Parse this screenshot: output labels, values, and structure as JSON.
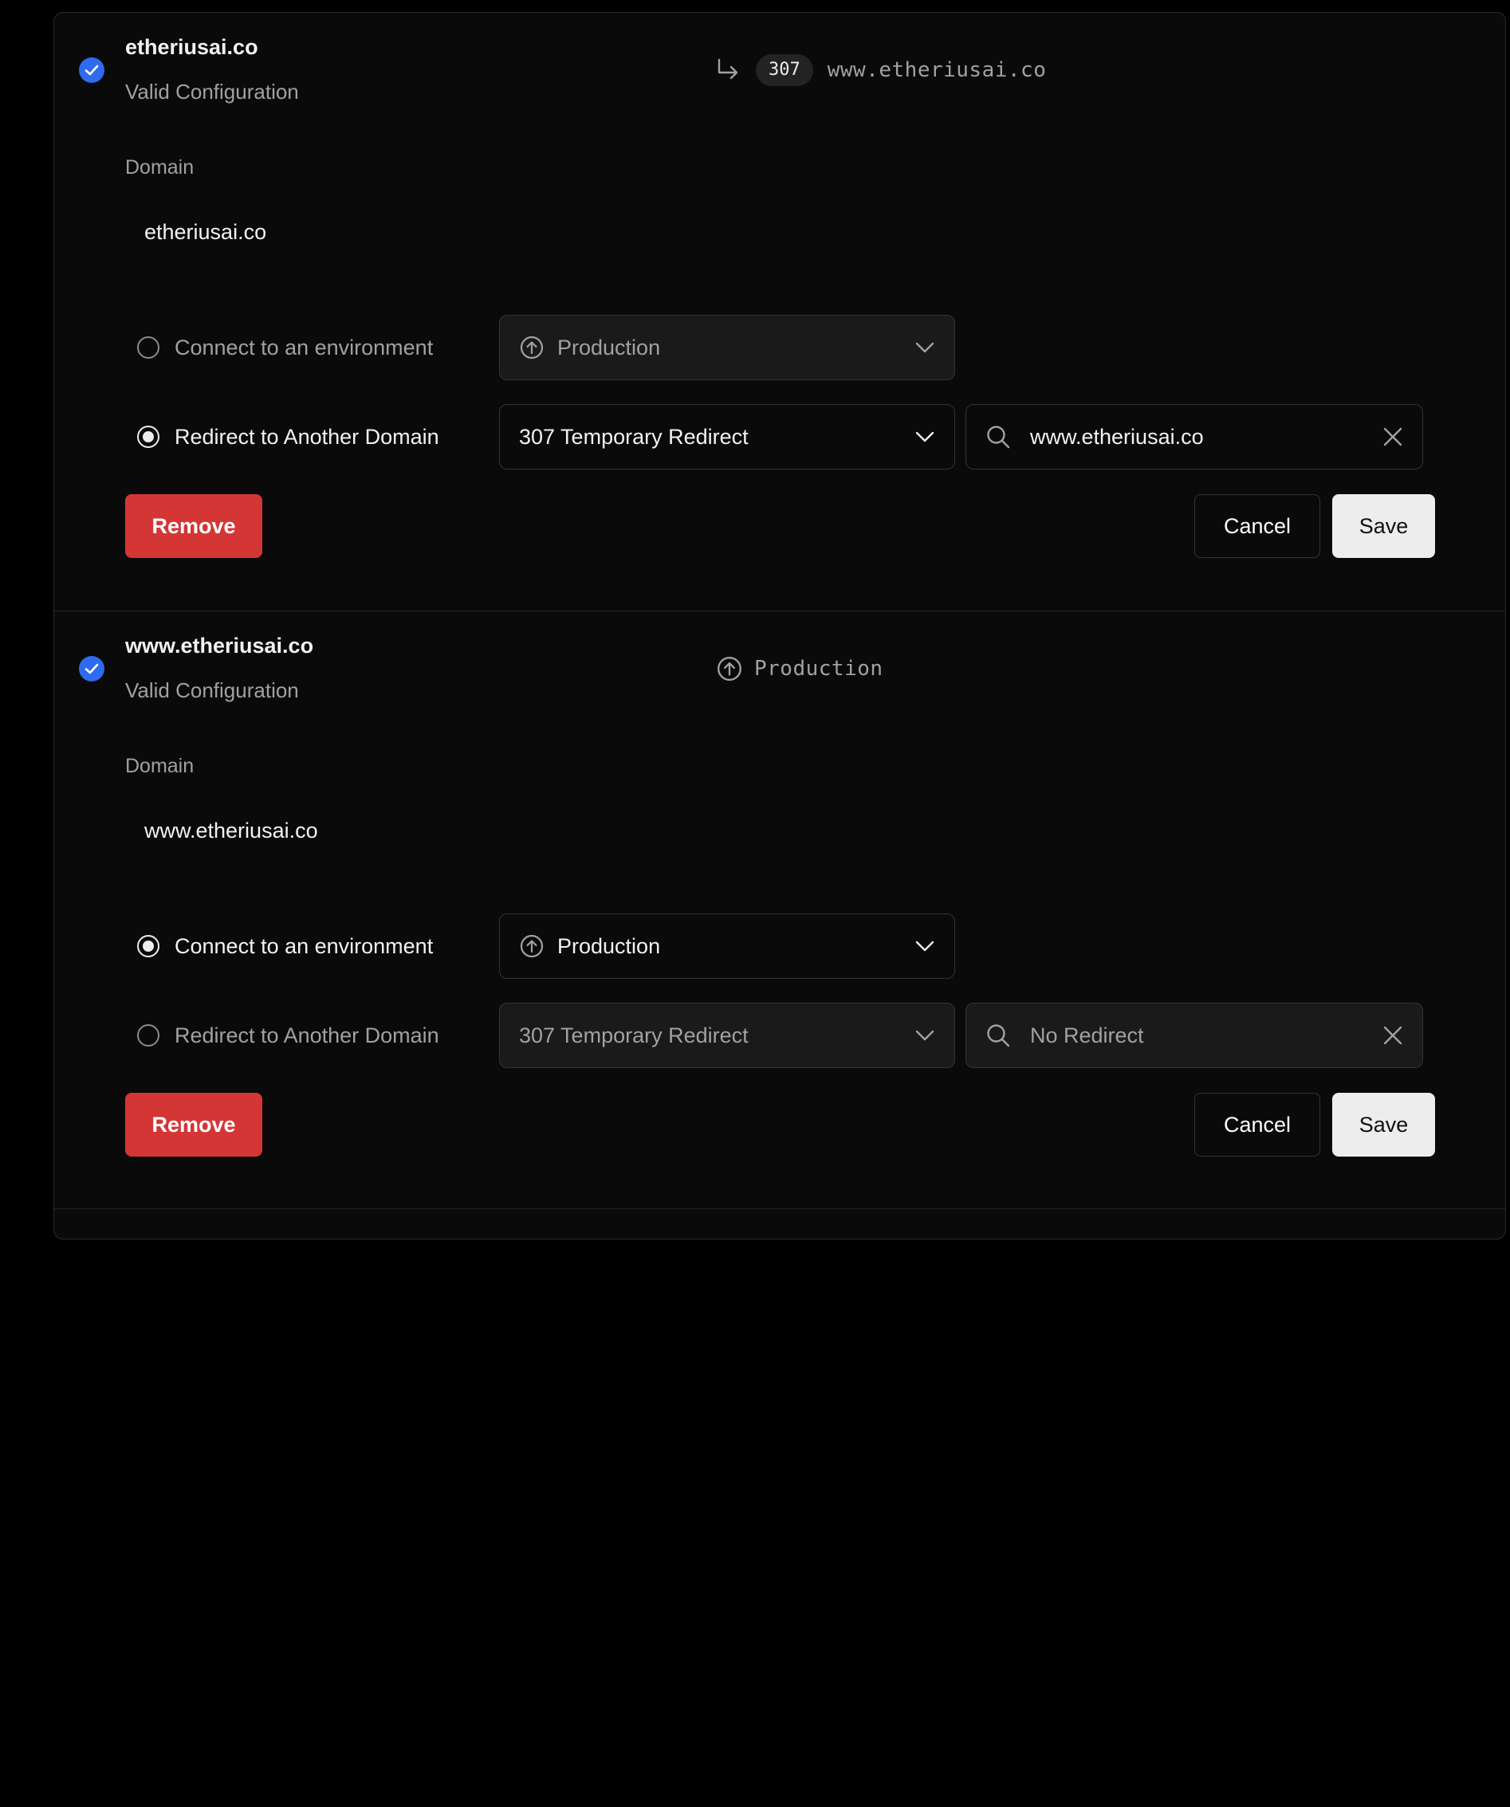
{
  "domains": [
    {
      "name": "etheriusai.co",
      "status": "Valid Configuration",
      "summary": {
        "type": "redirect",
        "code": "307",
        "target": "www.etheriusai.co"
      },
      "field_label": "Domain",
      "field_value": "etheriusai.co",
      "options": {
        "connect_label": "Connect to an environment",
        "redirect_label": "Redirect to Another Domain",
        "selected": "redirect"
      },
      "environment_select": "Production",
      "redirect_select": "307 Temporary Redirect",
      "redirect_target": {
        "value": "www.etheriusai.co",
        "placeholder": ""
      },
      "buttons": {
        "remove": "Remove",
        "cancel": "Cancel",
        "save": "Save"
      }
    },
    {
      "name": "www.etheriusai.co",
      "status": "Valid Configuration",
      "summary": {
        "type": "environment",
        "environment": "Production"
      },
      "field_label": "Domain",
      "field_value": "www.etheriusai.co",
      "options": {
        "connect_label": "Connect to an environment",
        "redirect_label": "Redirect to Another Domain",
        "selected": "connect"
      },
      "environment_select": "Production",
      "redirect_select": "307 Temporary Redirect",
      "redirect_target": {
        "value": "",
        "placeholder": "No Redirect"
      },
      "buttons": {
        "remove": "Remove",
        "cancel": "Cancel",
        "save": "Save"
      }
    }
  ],
  "icons": {
    "status": "check-circle-icon",
    "redirect": "redirect-arrow-icon",
    "environment": "arrow-up-circle-icon",
    "dropdown": "chevron-down-icon",
    "search": "search-icon",
    "clear": "close-icon"
  },
  "colors": {
    "check": "#2f6bee",
    "remove": "#d43636",
    "save_bg": "#ededed",
    "panel_bg": "#0a0a0a"
  }
}
